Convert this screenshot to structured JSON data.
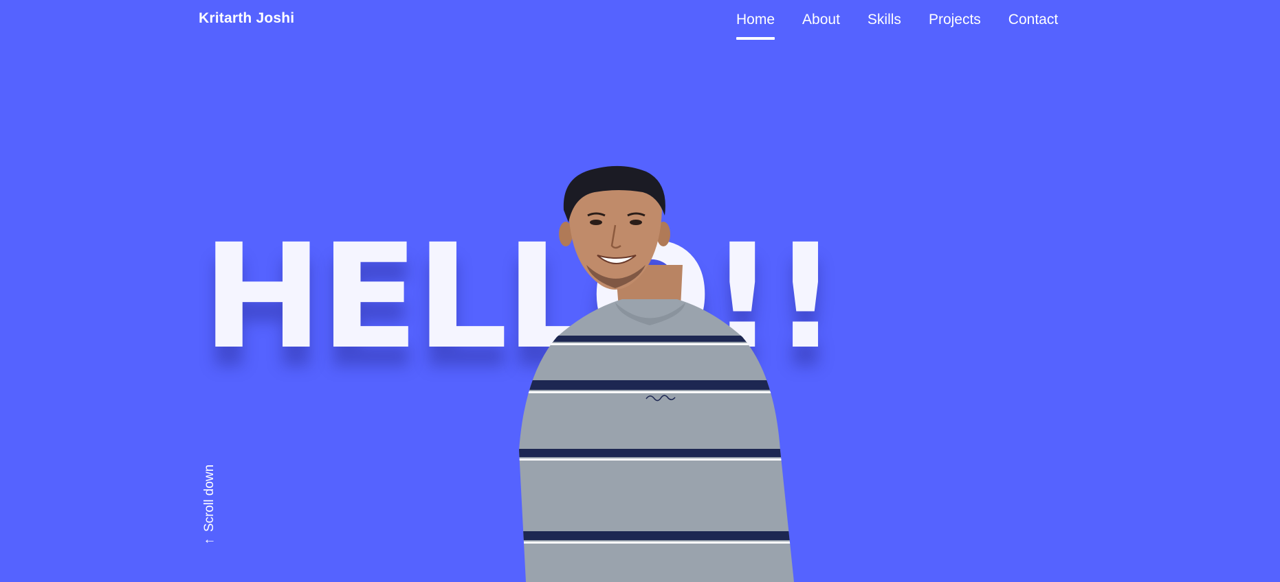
{
  "header": {
    "brand": "Kritarth Joshi",
    "nav": [
      {
        "label": "Home",
        "active": true
      },
      {
        "label": "About",
        "active": false
      },
      {
        "label": "Skills",
        "active": false
      },
      {
        "label": "Projects",
        "active": false
      },
      {
        "label": "Contact",
        "active": false
      }
    ]
  },
  "hero": {
    "headline": "HELLO!!",
    "portrait_icon": "person-portrait",
    "scroll_label": "Scroll down",
    "scroll_icon": "arrow-down-icon"
  },
  "colors": {
    "background": "#5563ff",
    "headline": "#f5f5ff",
    "nav_text": "#ffffff",
    "shirt": "#9aa3ad",
    "stripe": "#1d2752"
  }
}
